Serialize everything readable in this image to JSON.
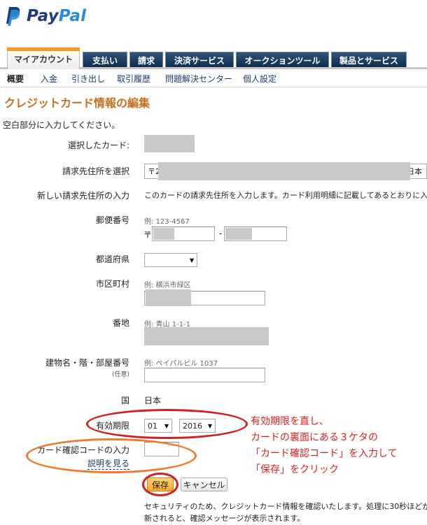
{
  "brand": {
    "pay": "Pay",
    "pal": "Pal"
  },
  "tabs": [
    {
      "label": "マイアカウント",
      "active": true
    },
    {
      "label": "支払い"
    },
    {
      "label": "請求"
    },
    {
      "label": "決済サービス"
    },
    {
      "label": "オークションツール"
    },
    {
      "label": "製品とサービス"
    }
  ],
  "subnav": [
    "概要",
    "入金",
    "引き出し",
    "取引履歴",
    "問題解決センター",
    "個人設定"
  ],
  "page_title": "クレジットカード情報の編集",
  "instruction": "空白部分に入力してください。",
  "form": {
    "selected_card_label": "選択したカード:",
    "billing_address_label": "請求先住所を選択",
    "billing_address_prefix": "〒2",
    "billing_address_suffix": "日本",
    "new_address_label": "新しい請求先住所の入力",
    "new_address_text": "このカードの請求先住所を入力します。カード利用明細に記載してあるとおりに入力",
    "postal_label": "郵便番号",
    "postal_example": "例: 123-4567",
    "postal_mark": "〒",
    "postal_dash": "-",
    "prefecture_label": "都道府県",
    "city_label": "市区町村",
    "city_example": "例: 横浜市緑区",
    "street_label": "番地",
    "street_example": "例: 青山 1-1-1",
    "building_label": "建物名・階・部屋番号",
    "building_optional": "(任意)",
    "building_example": "例: ペイパルビル 1037",
    "country_label": "国",
    "country_value": "日本",
    "expiry_label": "有効期限",
    "expiry_month": "01",
    "expiry_year": "2016",
    "cvv_label": "カード確認コードの入力",
    "cvv_help": "説明を見る",
    "save_label": "保存",
    "cancel_label": "キャンセル"
  },
  "note": [
    "セキュリティのため、クレジットカード情報を確認いたします。処理に30秒ほどかか",
    "新されると、確認メッセージが表示されます。"
  ],
  "annotation": [
    "有効期限を直し、",
    "カードの裏面にある３ケタの",
    "「カード確認コード」を入力して",
    "「保存」をクリック"
  ],
  "colors": {
    "title": "#c6701c",
    "annotation": "#d92020",
    "annotation_ring_red": "#d02020",
    "annotation_ring_orange": "#ee7a2e",
    "tab_dark": "#0d2c4c",
    "tab_active_top": "#f79a1e"
  }
}
